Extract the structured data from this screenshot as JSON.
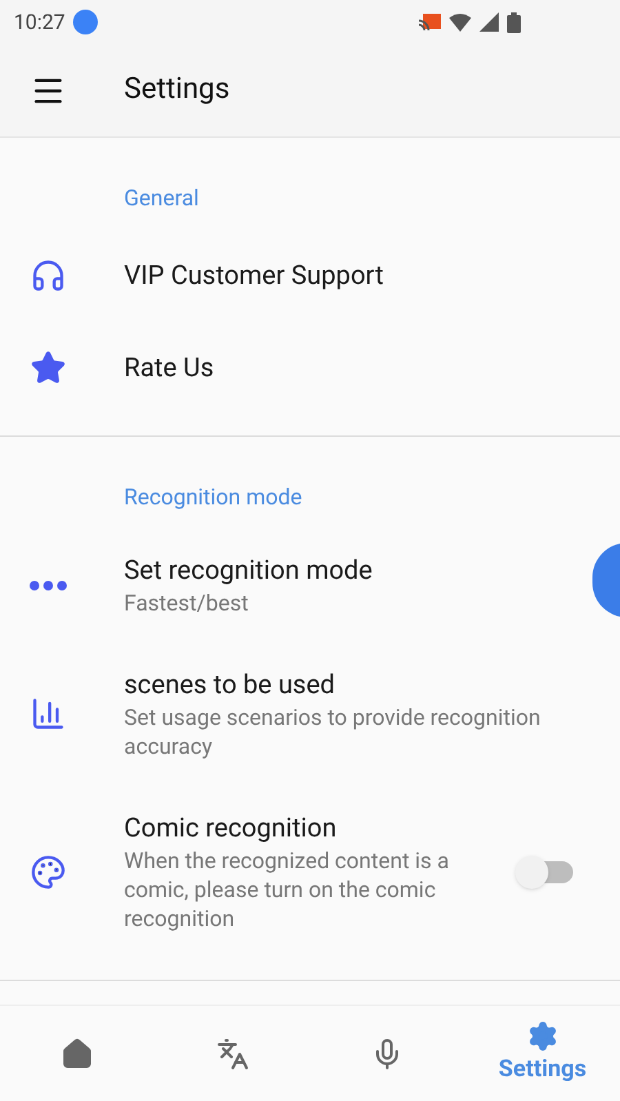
{
  "status_bar": {
    "time": "10:27"
  },
  "toolbar": {
    "title": "Settings"
  },
  "sections": [
    {
      "header": "General",
      "items": [
        {
          "kind": "plain",
          "title": "VIP Customer Support"
        },
        {
          "kind": "plain",
          "title": "Rate Us"
        }
      ]
    },
    {
      "header": "Recognition mode",
      "items": [
        {
          "kind": "plain",
          "title": "Set recognition mode",
          "summary": "Fastest/best"
        },
        {
          "kind": "plain",
          "title": "scenes to be used",
          "summary": "Set usage scenarios to provide recognition accuracy"
        },
        {
          "kind": "toggle",
          "title": "Comic recognition",
          "summary": "When the recognized content is a comic, please turn on the comic recognition",
          "on": false
        }
      ]
    }
  ],
  "bottom_nav": [
    {
      "selected": false
    },
    {
      "selected": false
    },
    {
      "selected": false
    },
    {
      "selected": true,
      "label": "Settings"
    }
  ]
}
